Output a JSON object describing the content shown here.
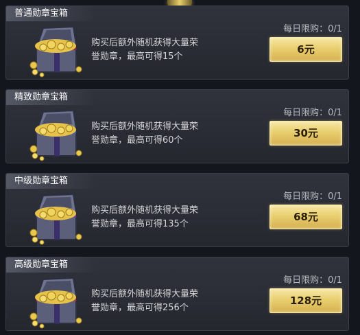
{
  "items": [
    {
      "title": "普通勋章宝箱",
      "desc_line1": "购买后额外随机获得大量荣",
      "desc_line2": "誉勋章，最高可得15个",
      "limit": "每日限购：0/1",
      "price": "6元"
    },
    {
      "title": "精致勋章宝箱",
      "desc_line1": "购买后额外随机获得大量荣",
      "desc_line2": "誉勋章，最高可得60个",
      "limit": "每日限购：0/1",
      "price": "30元"
    },
    {
      "title": "中级勋章宝箱",
      "desc_line1": "购买后额外随机获得大量荣",
      "desc_line2": "誉勋章，最高可得135个",
      "limit": "每日限购：0/1",
      "price": "68元"
    },
    {
      "title": "高级勋章宝箱",
      "desc_line1": "购买后额外随机获得大量荣",
      "desc_line2": "誉勋章，最高可得256个",
      "limit": "每日限购：0/1",
      "price": "128元"
    }
  ],
  "icons": {
    "chest": "medal-treasure-chest-icon"
  },
  "colors": {
    "background": "#14161d",
    "panel": "#2a2d35",
    "button_gold": "#e9cf70",
    "button_text": "#2a1e0a",
    "desc_text": "#d6d6d8",
    "limit_text": "#b8bac0"
  }
}
